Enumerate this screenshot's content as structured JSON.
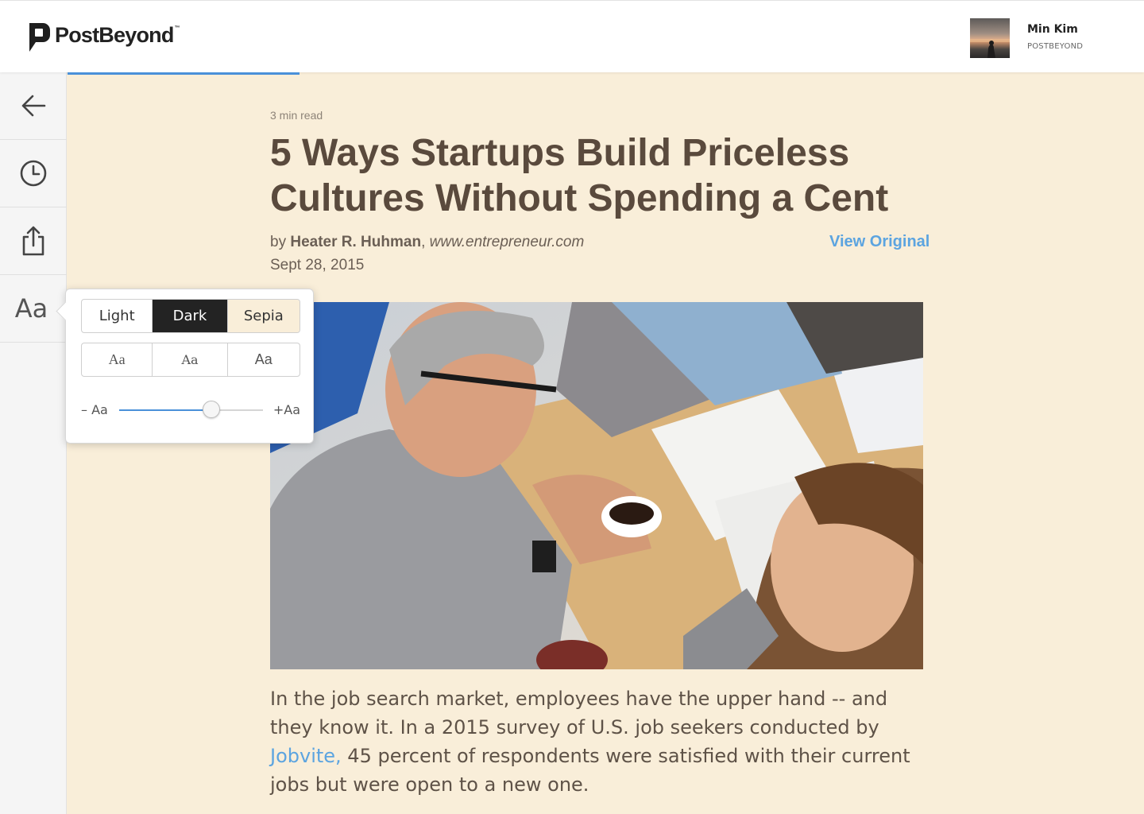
{
  "app": {
    "brand": "PostBeyond",
    "brand_tm": "™",
    "user": {
      "name": "Min Kim",
      "org": "POSTBEYOND"
    },
    "reading_progress": 0.22,
    "accent_color": "#4a90d9"
  },
  "sidebar": {
    "items": [
      {
        "name": "back",
        "icon": "arrow-left-icon"
      },
      {
        "name": "history",
        "icon": "clock-icon"
      },
      {
        "name": "share",
        "icon": "share-icon"
      },
      {
        "name": "text-settings",
        "label": "Aa"
      }
    ]
  },
  "popover": {
    "themes": [
      {
        "label": "Light",
        "selected": false
      },
      {
        "label": "Dark",
        "selected": true
      },
      {
        "label": "Sepia",
        "selected": false
      }
    ],
    "fonts": [
      "Aa",
      "Aa",
      "Aa"
    ],
    "size_min_label": "– Aa",
    "size_max_label": "+Aa",
    "size_level": 0.64
  },
  "article": {
    "read_time": "3 min read",
    "title": "5 Ways Startups Build Priceless Cultures Without Spending a Cent",
    "by_prefix": "by ",
    "author": "Heater R. Huhman",
    "separator": ", ",
    "source": "www.entrepreneur.com",
    "date": "Sept 28, 2015",
    "view_original": "View Original",
    "body_before_link": "In the job search market, employees have the upper hand -- and they know it. In a 2015 survey of U.S. job seekers conducted by ",
    "body_link": "Jobvite,",
    "body_after_link": " 45 percent of respondents were satisfied with their current jobs but were open to a new one."
  }
}
